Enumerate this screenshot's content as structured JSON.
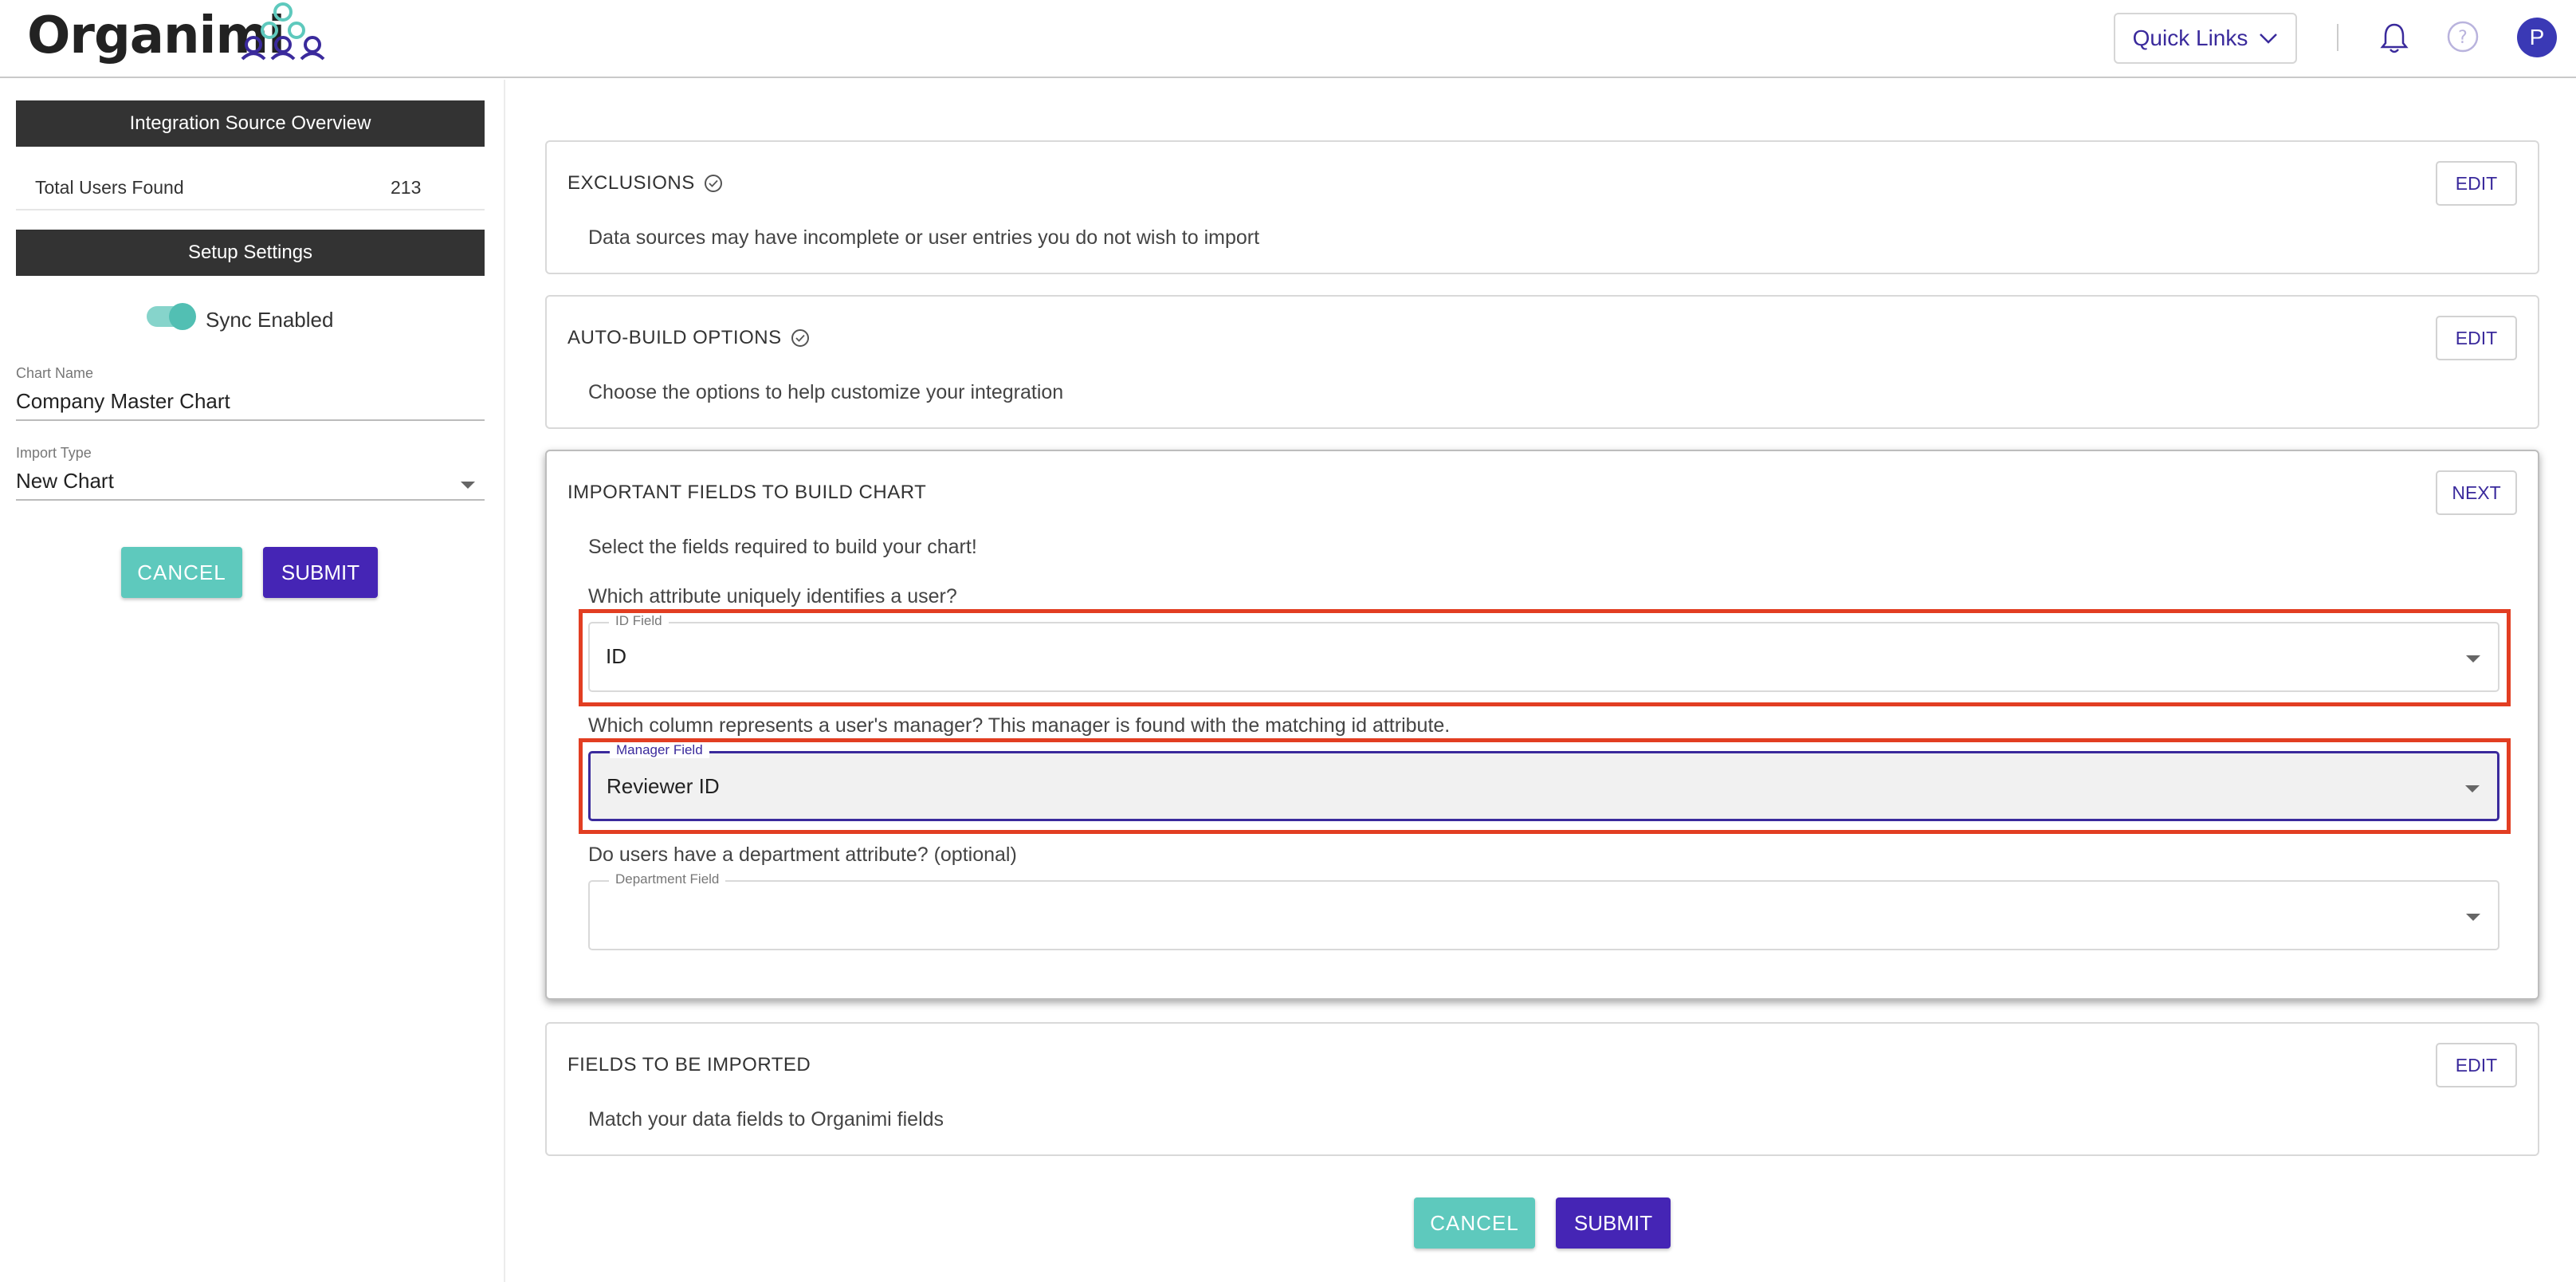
{
  "header": {
    "logo_text": "Organimi",
    "quick_links_label": "Quick Links",
    "avatar_initial": "P"
  },
  "sidebar": {
    "overview_title": "Integration Source Overview",
    "total_users_label": "Total Users Found",
    "total_users_value": "213",
    "setup_title": "Setup Settings",
    "sync_label": "Sync Enabled",
    "sync_enabled": true,
    "chart_name_label": "Chart Name",
    "chart_name_value": "Company Master Chart",
    "import_type_label": "Import Type",
    "import_type_value": "New Chart",
    "cancel_label": "CANCEL",
    "submit_label": "SUBMIT"
  },
  "cards": {
    "exclusions": {
      "title": "EXCLUSIONS",
      "button": "EDIT",
      "description": "Data sources may have incomplete or user entries you do not wish to import"
    },
    "auto_build": {
      "title": "AUTO-BUILD OPTIONS",
      "button": "EDIT",
      "description": "Choose the options to help customize your integration"
    },
    "important_fields": {
      "title": "IMPORTANT FIELDS TO BUILD CHART",
      "button": "NEXT",
      "description": "Select the fields required to build your chart!",
      "id_question": "Which attribute uniquely identifies a user?",
      "id_field_label": "ID Field",
      "id_field_value": "ID",
      "manager_question": "Which column represents a user's manager? This manager is found with the matching id attribute.",
      "manager_field_label": "Manager Field",
      "manager_field_value": "Reviewer ID",
      "department_question": "Do users have a department attribute? (optional)",
      "department_field_label": "Department Field",
      "department_field_value": ""
    },
    "fields_imported": {
      "title": "FIELDS TO BE IMPORTED",
      "button": "EDIT",
      "description": "Match your data fields to Organimi fields"
    }
  },
  "footer": {
    "cancel_label": "CANCEL",
    "submit_label": "SUBMIT"
  },
  "colors": {
    "brand_purple": "#4525b5",
    "teal": "#5ec9bd",
    "highlight_red": "#e23e22",
    "dark_bar": "#333333"
  }
}
